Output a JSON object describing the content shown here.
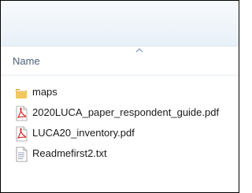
{
  "header": {
    "name_column_label": "Name"
  },
  "files": [
    {
      "name": "maps",
      "type": "folder",
      "icon": "folder-icon"
    },
    {
      "name": "2020LUCA_paper_respondent_guide.pdf",
      "type": "pdf",
      "icon": "pdf-file-icon"
    },
    {
      "name": "LUCA20_inventory.pdf",
      "type": "pdf",
      "icon": "pdf-file-icon"
    },
    {
      "name": "Readmefirst2.txt",
      "type": "txt",
      "icon": "text-file-icon"
    }
  ],
  "colors": {
    "folder": "#e8b84a",
    "pdf": "#d42a2a",
    "header_text": "#4c607a"
  }
}
